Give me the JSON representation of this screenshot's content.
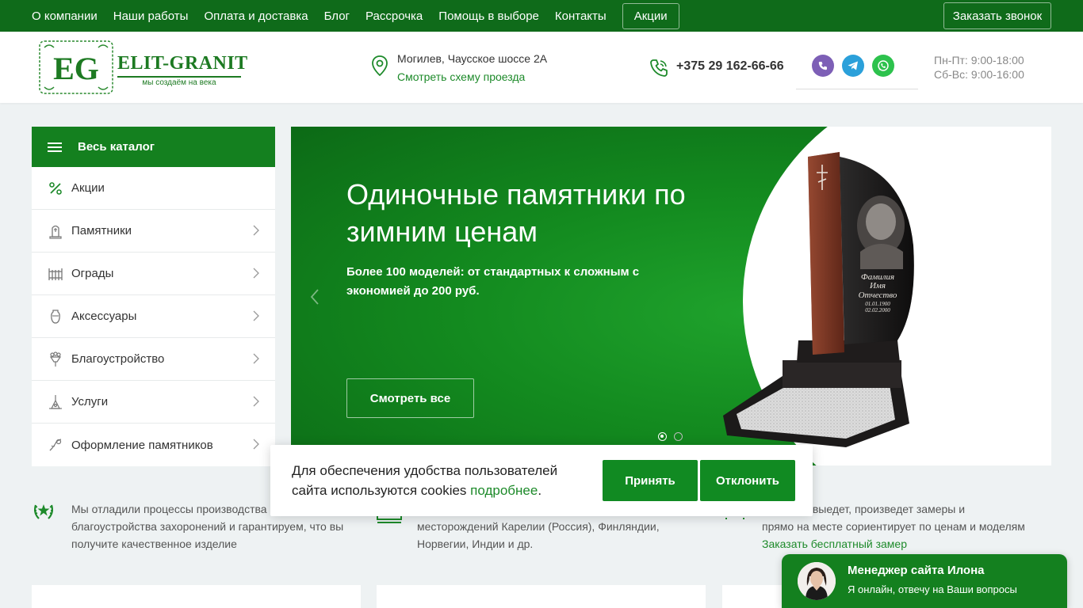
{
  "topnav": {
    "items": [
      "О компании",
      "Наши работы",
      "Оплата и доставка",
      "Блог",
      "Рассрочка",
      "Помощь в выборе",
      "Контакты"
    ],
    "promo": "Акции",
    "callback": "Заказать звонок"
  },
  "header": {
    "logo": {
      "initials": "EG",
      "brand": "ELIT-GRANIT",
      "tagline": "мы создаём на века"
    },
    "address": "Могилев, Чаусское шоссе 2А",
    "map_link": "Смотреть схему проезда",
    "phone": "+375 29 162-66-66",
    "messengers": [
      "viber-icon",
      "telegram-icon",
      "whatsapp-icon"
    ],
    "hours": [
      "Пн-Пт: 9:00-18:00",
      "Сб-Вс: 9:00-16:00"
    ]
  },
  "catalog": {
    "title": "Весь каталог",
    "items": [
      {
        "label": "Акции",
        "icon": "percent-icon"
      },
      {
        "label": "Памятники",
        "icon": "monument-icon"
      },
      {
        "label": "Ограды",
        "icon": "fence-icon"
      },
      {
        "label": "Аксессуары",
        "icon": "vase-icon"
      },
      {
        "label": "Благоустройство",
        "icon": "flowers-icon"
      },
      {
        "label": "Услуги",
        "icon": "tools-icon"
      },
      {
        "label": "Оформление памятников",
        "icon": "engraving-icon"
      }
    ]
  },
  "hero": {
    "title": "Одиночные памятники по зимним ценам",
    "subtitle": "Более 100 моделей: от стандартных к сложным с экономией до 200 руб.",
    "button": "Смотреть все",
    "slides": 2,
    "active_slide": 1,
    "monument_text": [
      "Фамилия",
      "Имя",
      "Отчество",
      "01.01.1900",
      "02.02.2000"
    ]
  },
  "features": [
    {
      "text": [
        "Мы отладили процессы производства",
        "благоустройства захоронений и гарантируем, что вы",
        "получите качественное изделие"
      ],
      "icon": "wreath-icon"
    },
    {
      "text": [
        "",
        "месторождений Карелии (Россия), Финляндии,",
        "Норвегии, Индии и др."
      ],
      "icon": "stone-icon"
    },
    {
      "text": [
        "есплатно выедет, произведет замеры и",
        "прямо на месте сориентирует по ценам и моделям"
      ],
      "link": "Заказать бесплатный замер",
      "icon": "measure-icon"
    }
  ],
  "cookie": {
    "text_before": "Для обеспечения удобства пользователей сайта используются cookies ",
    "link": "подробнее",
    "text_after": ".",
    "accept": "Принять",
    "reject": "Отклонить"
  },
  "chat": {
    "name": "Менеджер сайта Илона",
    "status": "Я онлайн, отвечу на Ваши вопросы"
  },
  "colors": {
    "brand_green": "#14801f",
    "top_green": "#0f6b1a",
    "link_green": "#1d8a2a"
  }
}
